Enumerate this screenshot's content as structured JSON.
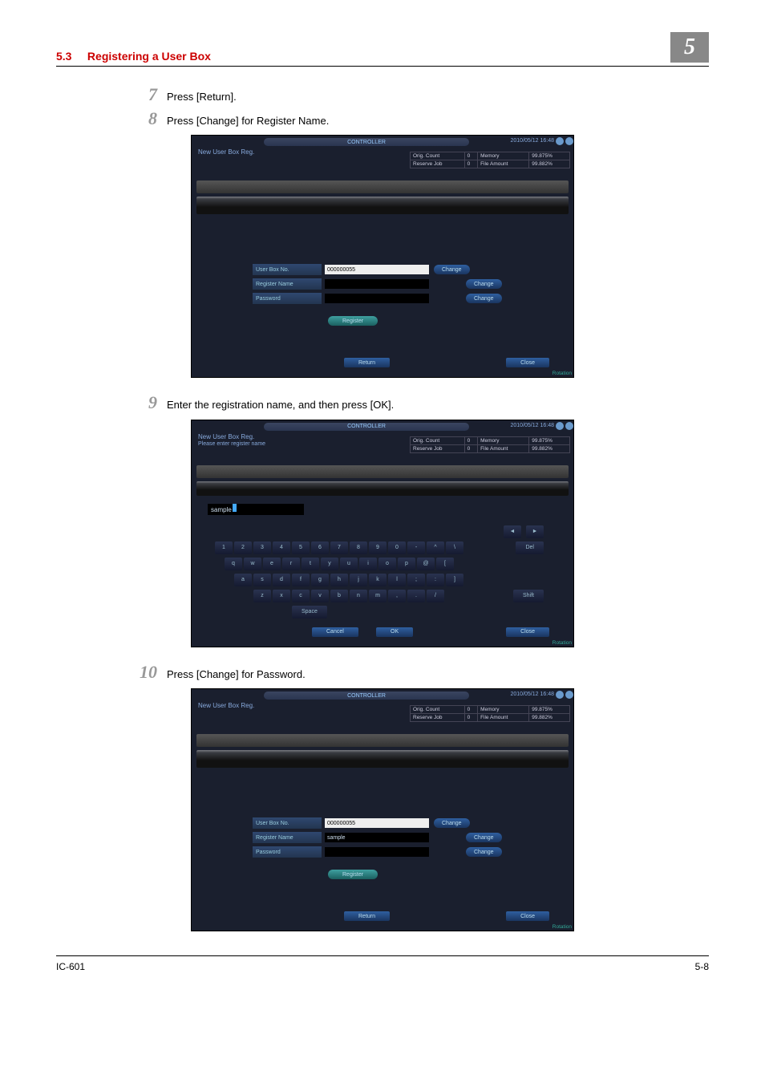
{
  "header": {
    "section": "5.3",
    "title": "Registering a User Box",
    "chapter": "5"
  },
  "steps": {
    "s7": {
      "num": "7",
      "text": "Press [Return]."
    },
    "s8": {
      "num": "8",
      "text": "Press [Change] for Register Name."
    },
    "s9": {
      "num": "9",
      "text": "Enter the registration name, and then press [OK]."
    },
    "s10": {
      "num": "10",
      "text": "Press [Change] for Password."
    }
  },
  "screen": {
    "controller": "CONTROLLER",
    "datetime": "2010/05/12 16:48",
    "title": "New User Box Reg.",
    "subtitle": "Please enter register name",
    "stats": {
      "r1c1": "Orig. Count",
      "r1c2": "0",
      "r1c3": "Memory",
      "r1c4": "99.875%",
      "r2c1": "Reserve Job",
      "r2c2": "0",
      "r2c3": "File Amount",
      "r2c4": "99.882%"
    },
    "labels": {
      "userbox": "User Box No.",
      "regname": "Register Name",
      "password": "Password"
    },
    "values": {
      "userboxno": "000000055",
      "sample": "sample"
    },
    "buttons": {
      "change": "Change",
      "register": "Register",
      "ret": "Return",
      "close": "Close",
      "cancel": "Cancel",
      "ok": "OK",
      "del": "Del",
      "shift": "Shift",
      "space": "Space"
    },
    "rotation": "Rotation"
  },
  "keyboard": {
    "row1": [
      "1",
      "2",
      "3",
      "4",
      "5",
      "6",
      "7",
      "8",
      "9",
      "0",
      "-",
      "^",
      "\\"
    ],
    "row2": [
      "q",
      "w",
      "e",
      "r",
      "t",
      "y",
      "u",
      "i",
      "o",
      "p",
      "@",
      "["
    ],
    "row3": [
      "a",
      "s",
      "d",
      "f",
      "g",
      "h",
      "j",
      "k",
      "l",
      ";",
      ":",
      "]"
    ],
    "row4": [
      "z",
      "x",
      "c",
      "v",
      "b",
      "n",
      "m",
      ",",
      ".",
      "/"
    ]
  },
  "footer": {
    "left": "IC-601",
    "right": "5-8"
  }
}
